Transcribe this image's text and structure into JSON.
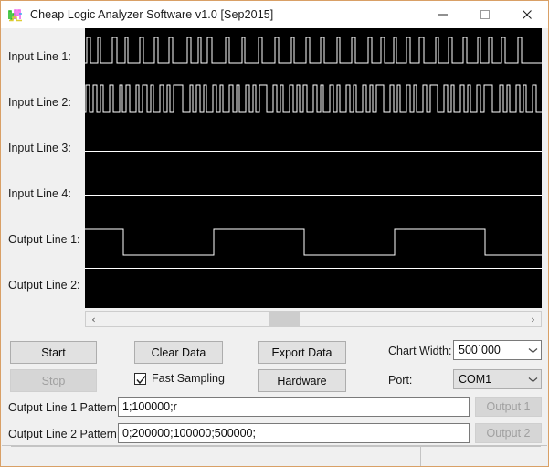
{
  "window": {
    "title": "Cheap Logic Analyzer Software v1.0 [Sep2015]",
    "icon": "logic-waveform-icon",
    "border_color": "#D9A066",
    "controls": {
      "minimize": "minimize-icon",
      "maximize": "maximize-icon",
      "close": "close-icon"
    }
  },
  "channels": [
    {
      "label": "Input Line 1:",
      "name": "input-line-1"
    },
    {
      "label": "Input Line 2:",
      "name": "input-line-2"
    },
    {
      "label": "Input Line 3:",
      "name": "input-line-3"
    },
    {
      "label": "Input Line 4:",
      "name": "input-line-4"
    },
    {
      "label": "Output Line 1:",
      "name": "output-line-1"
    },
    {
      "label": "Output Line 2:",
      "name": "output-line-2"
    }
  ],
  "scope": {
    "background": "#000000",
    "trace_color": "#FFFFFF"
  },
  "scrollbar": {
    "left_arrow": "‹",
    "right_arrow": "›",
    "thumb_position_percent": 40
  },
  "buttons": {
    "start": "Start",
    "stop": "Stop",
    "clear_data": "Clear Data",
    "export_data": "Export Data",
    "hardware": "Hardware",
    "output_1": "Output 1",
    "output_2": "Output 2"
  },
  "checkbox": {
    "fast_sampling_label": "Fast Sampling",
    "fast_sampling_checked": true
  },
  "settings": {
    "chart_width_label": "Chart Width:",
    "chart_width_value": "500`000",
    "port_label": "Port:",
    "port_value": "COM1",
    "dropdown_arrow": "chevron-down-icon"
  },
  "patterns": {
    "line1_label": "Output Line 1 Pattern:",
    "line1_value": "1;100000;r",
    "line2_label": "Output Line 2 Pattern:",
    "line2_value": "0;200000;100000;500000;"
  },
  "status_bar": {
    "cell_1": "",
    "cell_2": ""
  }
}
